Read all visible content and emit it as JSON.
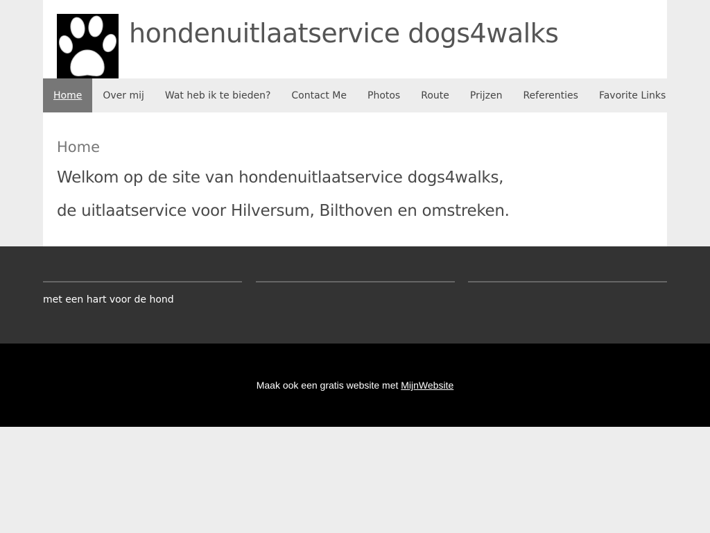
{
  "header": {
    "logo_name": "paw-print-logo",
    "site_title": "hondenuitlaatservice dogs4walks"
  },
  "nav": {
    "items": [
      {
        "label": "Home",
        "active": true
      },
      {
        "label": "Over mij"
      },
      {
        "label": "Wat heb ik te bieden?"
      },
      {
        "label": "Contact Me"
      },
      {
        "label": "Photos"
      },
      {
        "label": "Route"
      },
      {
        "label": "Prijzen"
      },
      {
        "label": "Referenties"
      },
      {
        "label": "Favorite Links"
      }
    ]
  },
  "main": {
    "page_title": "Home",
    "welcome_line_1": "Welkom op de site van hondenuitlaatservice dogs4walks,",
    "welcome_line_2": "de uitlaatservice voor Hilversum, Bilthoven en omstreken."
  },
  "footer": {
    "tagline": "met een hart voor de hond"
  },
  "bottom_bar": {
    "text": "Maak ook een gratis website met ",
    "link_label": "MijnWebsite"
  },
  "colors": {
    "page_background": "#ededed",
    "nav_active": "#777777",
    "footer": "#333333",
    "bottom_bar": "#000000"
  }
}
